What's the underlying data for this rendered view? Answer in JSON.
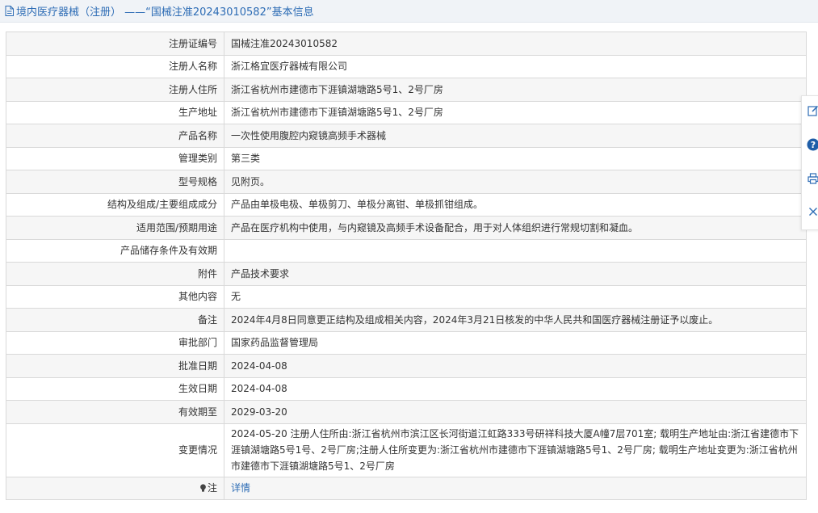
{
  "header": {
    "title": "境内医疗器械（注册） ——“国械注准20243010582”基本信息"
  },
  "rows": [
    {
      "label": "注册证编号",
      "value": "国械注准20243010582"
    },
    {
      "label": "注册人名称",
      "value": "浙江格宜医疗器械有限公司"
    },
    {
      "label": "注册人住所",
      "value": "浙江省杭州市建德市下涯镇湖塘路5号1、2号厂房"
    },
    {
      "label": "生产地址",
      "value": "浙江省杭州市建德市下涯镇湖塘路5号1、2号厂房"
    },
    {
      "label": "产品名称",
      "value": "一次性使用腹腔内窥镜高频手术器械"
    },
    {
      "label": "管理类别",
      "value": "第三类"
    },
    {
      "label": "型号规格",
      "value": "见附页。"
    },
    {
      "label": "结构及组成/主要组成成分",
      "value": "产品由单极电极、单极剪刀、单极分离钳、单极抓钳组成。"
    },
    {
      "label": "适用范围/预期用途",
      "value": "产品在医疗机构中使用，与内窥镜及高频手术设备配合，用于对人体组织进行常规切割和凝血。"
    },
    {
      "label": "产品储存条件及有效期",
      "value": ""
    },
    {
      "label": "附件",
      "value": "产品技术要求"
    },
    {
      "label": "其他内容",
      "value": "无"
    },
    {
      "label": "备注",
      "value": "2024年4月8日同意更正结构及组成相关内容，2024年3月21日核发的中华人民共和国医疗器械注册证予以废止。"
    },
    {
      "label": "审批部门",
      "value": "国家药品监督管理局"
    },
    {
      "label": "批准日期",
      "value": "2024-04-08"
    },
    {
      "label": "生效日期",
      "value": "2024-04-08"
    },
    {
      "label": "有效期至",
      "value": "2029-03-20"
    },
    {
      "label": "变更情况",
      "value": "2024-05-20 注册人住所由:浙江省杭州市滨江区长河街道江虹路333号研祥科技大厦A幢7层701室; 载明生产地址由:浙江省建德市下涯镇湖塘路5号1号、2号厂房;注册人住所变更为:浙江省杭州市建德市下涯镇湖塘路5号1、2号厂房; 载明生产地址变更为:浙江省杭州市建德市下涯镇湖塘路5号1、2号厂房"
    }
  ],
  "note": {
    "label": "注",
    "link": "详情"
  },
  "toolbar": {
    "icons": [
      "edit-icon",
      "help-icon",
      "print-icon",
      "close-icon"
    ]
  },
  "colors": {
    "link": "#2d6cb5",
    "help": "#1f5ea8",
    "header_bg": "#f0f3f7",
    "row_alt": "#f6f6f6"
  }
}
